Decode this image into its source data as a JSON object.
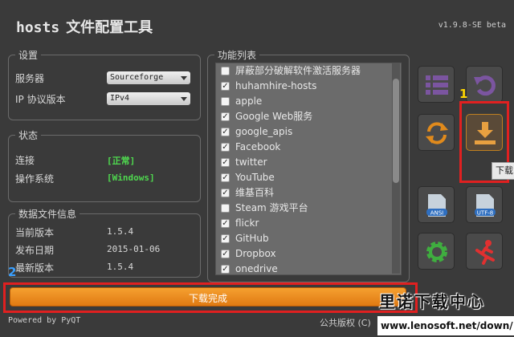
{
  "app": {
    "title_latin": "hosts",
    "title_cn": "文件配置工具",
    "version": "v1.9.8-SE beta"
  },
  "settings": {
    "title": "设置",
    "server_label": "服务器",
    "server_value": "Sourceforge",
    "ip_label": "IP 协议版本",
    "ip_value": "IPv4"
  },
  "status": {
    "title": "状态",
    "connection_label": "连接",
    "connection_value": "[正常]",
    "os_label": "操作系统",
    "os_value": "[Windows]"
  },
  "datafile": {
    "title": "数据文件信息",
    "current_label": "当前版本",
    "current_value": "1.5.4",
    "release_label": "发布日期",
    "release_value": "2015-01-06",
    "latest_label": "最新版本",
    "latest_value": "1.5.4"
  },
  "features": {
    "title": "功能列表",
    "items": [
      {
        "label": "屏蔽部分破解软件激活服务器",
        "checked": false
      },
      {
        "label": "huhamhire-hosts",
        "checked": true
      },
      {
        "label": "apple",
        "checked": false
      },
      {
        "label": "Google Web服务",
        "checked": true
      },
      {
        "label": "google_apis",
        "checked": true
      },
      {
        "label": "Facebook",
        "checked": true
      },
      {
        "label": "twitter",
        "checked": true
      },
      {
        "label": "YouTube",
        "checked": true
      },
      {
        "label": "维基百科",
        "checked": true
      },
      {
        "label": "Steam 游戏平台",
        "checked": false
      },
      {
        "label": "flickr",
        "checked": true
      },
      {
        "label": "GitHub",
        "checked": true
      },
      {
        "label": "Dropbox",
        "checked": true
      },
      {
        "label": "onedrive",
        "checked": true
      }
    ]
  },
  "buttons": {
    "ansi_label": "ANSI",
    "utf8_label": "UTF-8",
    "tooltip": "下载"
  },
  "annotations": {
    "one": "1",
    "two": "2"
  },
  "progress": {
    "text": "下载完成",
    "value": 1.0
  },
  "footer": {
    "powered": "Powered by PyQT",
    "copyright": "公共版权 (C)"
  },
  "watermark": {
    "text": "里诺下载中心",
    "url": "www.lenosoft.net/down/"
  },
  "colors": {
    "accent_orange": "#f09020",
    "status_green": "#4fd94f",
    "annotation_red": "#e02020",
    "annotation_yellow": "#ffd700",
    "annotation_blue": "#3aa0ff"
  }
}
